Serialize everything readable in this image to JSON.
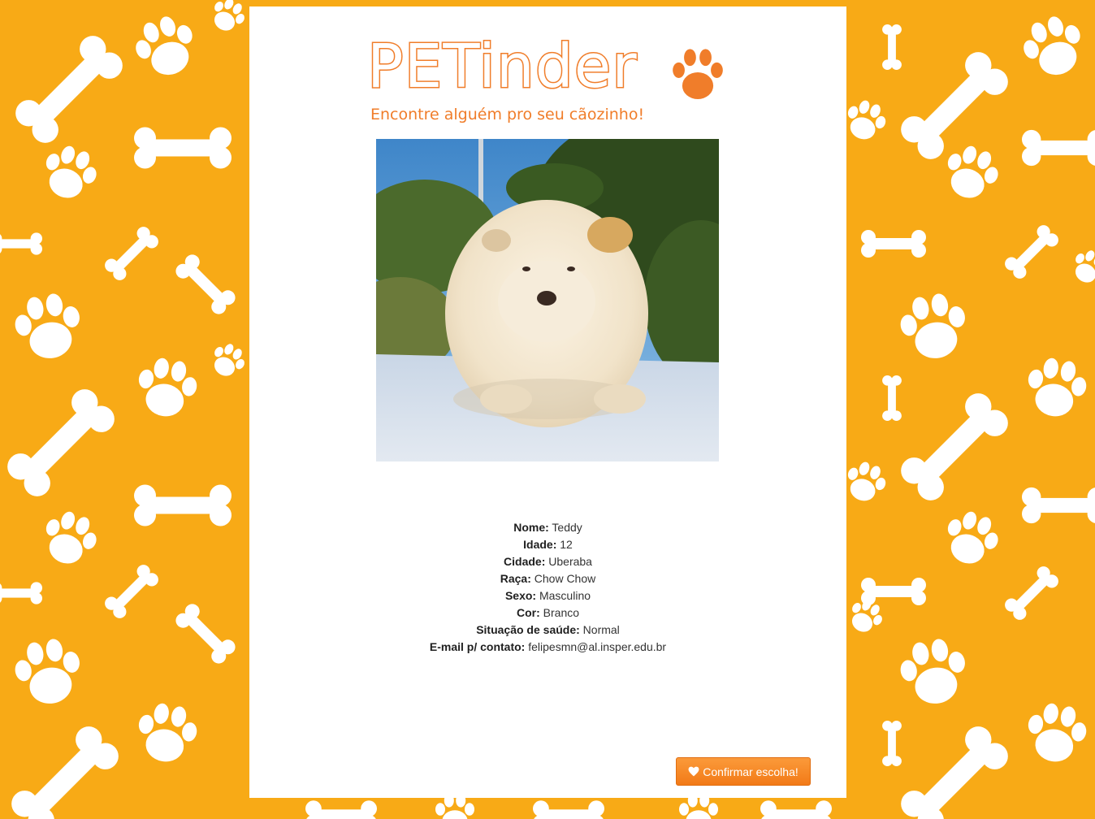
{
  "header": {
    "title": "PETinder",
    "tagline": "Encontre alguém pro seu cãozinho!",
    "logo_icon": "paw-icon"
  },
  "pet": {
    "photo_description": "puppy-photo",
    "fields": [
      {
        "label": "Nome:",
        "value": "Teddy"
      },
      {
        "label": "Idade:",
        "value": "12"
      },
      {
        "label": "Cidade:",
        "value": "Uberaba"
      },
      {
        "label": "Raça:",
        "value": "Chow Chow"
      },
      {
        "label": "Sexo:",
        "value": "Masculino"
      },
      {
        "label": "Cor:",
        "value": "Branco"
      },
      {
        "label": "Situação de saúde:",
        "value": "Normal"
      },
      {
        "label": "E-mail p/ contato:",
        "value": "felipesmn@al.insper.edu.br"
      }
    ]
  },
  "actions": {
    "confirm_label": "Confirmar escolha!",
    "confirm_icon": "heart-icon"
  },
  "colors": {
    "background": "#f8aa16",
    "accent": "#f07d2a",
    "button": "#f58420"
  }
}
